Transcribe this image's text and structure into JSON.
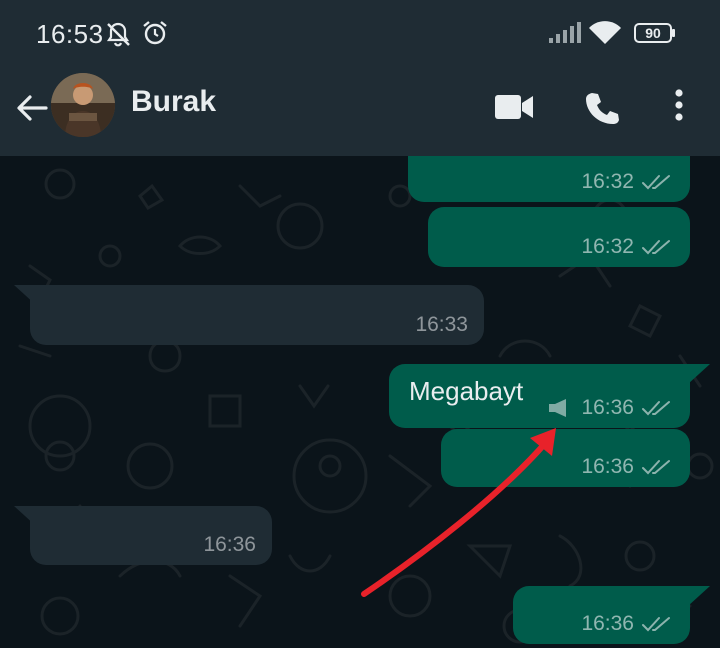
{
  "status_bar": {
    "time": "16:53",
    "battery": "90"
  },
  "app_bar": {
    "contact_name": "Burak"
  },
  "messages": [
    {
      "direction": "out",
      "text": "",
      "time": "16:32"
    },
    {
      "direction": "out",
      "text": "",
      "time": "16:32"
    },
    {
      "direction": "in",
      "text": "",
      "time": "16:33"
    },
    {
      "direction": "out",
      "text": "Megabayt",
      "time": "16:36"
    },
    {
      "direction": "out",
      "text": "",
      "time": "16:36"
    },
    {
      "direction": "in",
      "text": "",
      "time": "16:36"
    },
    {
      "direction": "out",
      "text": "",
      "time": "16:36"
    }
  ],
  "colors": {
    "outgoing_bubble": "#005c4b",
    "incoming_bubble": "#1f2c34",
    "header": "#1f2c34",
    "background": "#0b141a",
    "annotation_arrow": "#e8222a"
  }
}
